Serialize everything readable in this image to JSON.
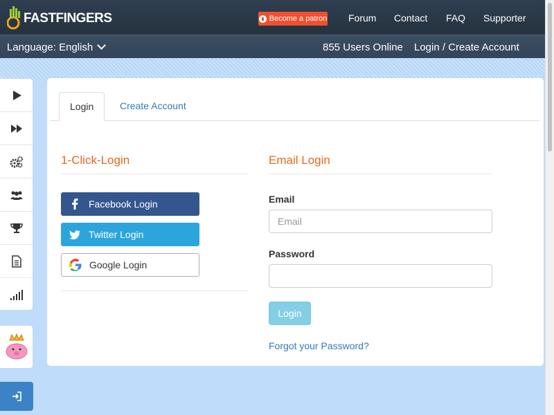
{
  "header": {
    "logo_text": "FASTFINGERS",
    "patron_label": "Become a patron",
    "nav": [
      "Forum",
      "Contact",
      "FAQ",
      "Supporter"
    ]
  },
  "subbar": {
    "language": "Language: English",
    "users_online": "855 Users Online",
    "login_link": "Login / Create Account"
  },
  "tabs": {
    "login": "Login",
    "create": "Create Account"
  },
  "one_click": {
    "title": "1-Click-Login",
    "facebook": "Facebook Login",
    "twitter": "Twitter Login",
    "google": "Google Login"
  },
  "email_login": {
    "title": "Email Login",
    "email_label": "Email",
    "email_placeholder": "Email",
    "password_label": "Password",
    "login_button": "Login",
    "forgot": "Forgot your Password?"
  },
  "sidebar_icons": [
    "play-icon",
    "fast-forward-icon",
    "gears-icon",
    "users-icon",
    "trophy-icon",
    "document-icon",
    "signal-bars-icon"
  ],
  "colors": {
    "accent_orange": "#e8671e",
    "link_blue": "#337ab7",
    "facebook": "#34568f",
    "twitter": "#2ca5dc",
    "patron": "#f0502f"
  }
}
